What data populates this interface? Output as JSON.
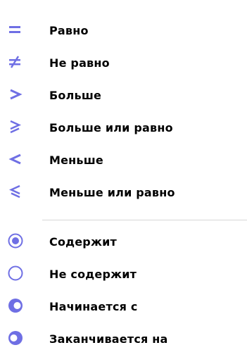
{
  "colors": {
    "accent": "#6f6fe4",
    "text": "#000000",
    "separator": "#d6d6d6"
  },
  "menu": {
    "items": [
      {
        "label": "Равно",
        "icon": "equals-icon"
      },
      {
        "label": "Не равно",
        "icon": "not-equals-icon"
      },
      {
        "label": "Больше",
        "icon": "greater-than-icon"
      },
      {
        "label": "Больше или равно",
        "icon": "greater-or-equal-icon"
      },
      {
        "label": "Меньше",
        "icon": "less-than-icon"
      },
      {
        "label": "Меньше или равно",
        "icon": "less-or-equal-icon"
      },
      {
        "label": "Содержит",
        "icon": "contains-icon"
      },
      {
        "label": "Не содержит",
        "icon": "not-contains-icon"
      },
      {
        "label": "Начинается с",
        "icon": "starts-with-icon"
      },
      {
        "label": "Заканчивается на",
        "icon": "ends-with-icon"
      }
    ]
  }
}
